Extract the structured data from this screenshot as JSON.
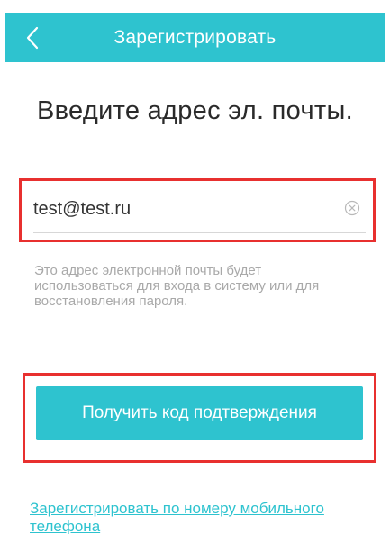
{
  "header": {
    "title": "Зарегистрировать",
    "back_icon": "chevron-left-icon",
    "color": "#2ec3cf"
  },
  "main": {
    "heading": "Введите адрес эл. почты.",
    "email": {
      "value": "test@test.ru",
      "clear_icon": "clear-circle-icon"
    },
    "hint": "Это адрес электронной почты будет использоваться для входа в систему или для восстановления пароля.",
    "primary_button": "Получить код подтверждения",
    "alt_link": "Зарегистрировать по номеру мобильного телефона"
  },
  "colors": {
    "accent": "#2ec3cf",
    "highlight": "#e8302f",
    "hint": "#a9a9a9"
  }
}
